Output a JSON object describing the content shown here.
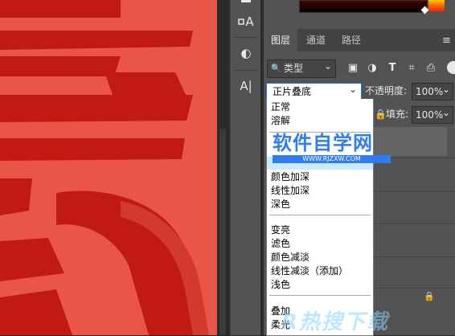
{
  "colors": {
    "canvas_bg": "#e95546",
    "canvas_dark": "#c11a12",
    "panel_bg": "#535353",
    "tab_bar_bg": "#434343",
    "selection_border": "#1f6fd1",
    "watermark_blue": "#2e7df0"
  },
  "tools": [
    {
      "icon": "path-select-icon"
    },
    {
      "icon": "type-tool-icon"
    },
    {
      "icon": "adjustment-icon"
    },
    {
      "icon": "paragraph-type-icon"
    }
  ],
  "tools_glyphs": {
    "type_a": "A",
    "adjust": "◐",
    "para": "A|"
  },
  "layers_panel": {
    "tabs": [
      {
        "label": "图层",
        "active": true
      },
      {
        "label": "通道",
        "active": false
      },
      {
        "label": "路径",
        "active": false
      }
    ],
    "menu_icon": "≡",
    "filter": {
      "label": "类型",
      "search_glyph": "🔍",
      "chevron": "⌄"
    },
    "filter_icons": [
      {
        "name": "image-filter-icon",
        "glyph": "▣"
      },
      {
        "name": "adjustment-filter-icon",
        "glyph": "◑"
      },
      {
        "name": "type-filter-icon",
        "glyph": "T"
      },
      {
        "name": "shape-filter-icon",
        "glyph": "⌗"
      },
      {
        "name": "smart-object-filter-icon",
        "glyph": "⎙"
      }
    ],
    "blend_mode": {
      "value": "正片叠底",
      "chevron": "⌄"
    },
    "opacity": {
      "label": "不透明度:",
      "value": "100%",
      "chevron": "⌄"
    },
    "fill": {
      "label": "填充:",
      "value": "100%",
      "chevron": "⌄",
      "lock_glyph": "🔒"
    },
    "lock_glyph": "🔒"
  },
  "blend_modes": {
    "group1": [
      "正常",
      "溶解"
    ],
    "group2": [
      "颜色加深",
      "线性加深",
      "深色"
    ],
    "group3": [
      "变亮",
      "滤色",
      "颜色减淡",
      "线性减淡（添加）",
      "浅色"
    ],
    "group4": [
      "叠加",
      "柔光"
    ]
  },
  "watermarks": {
    "site_name": "软件自学网",
    "site_url": "WWW.RJZXW.COM",
    "bottom": "R热搜下载"
  }
}
